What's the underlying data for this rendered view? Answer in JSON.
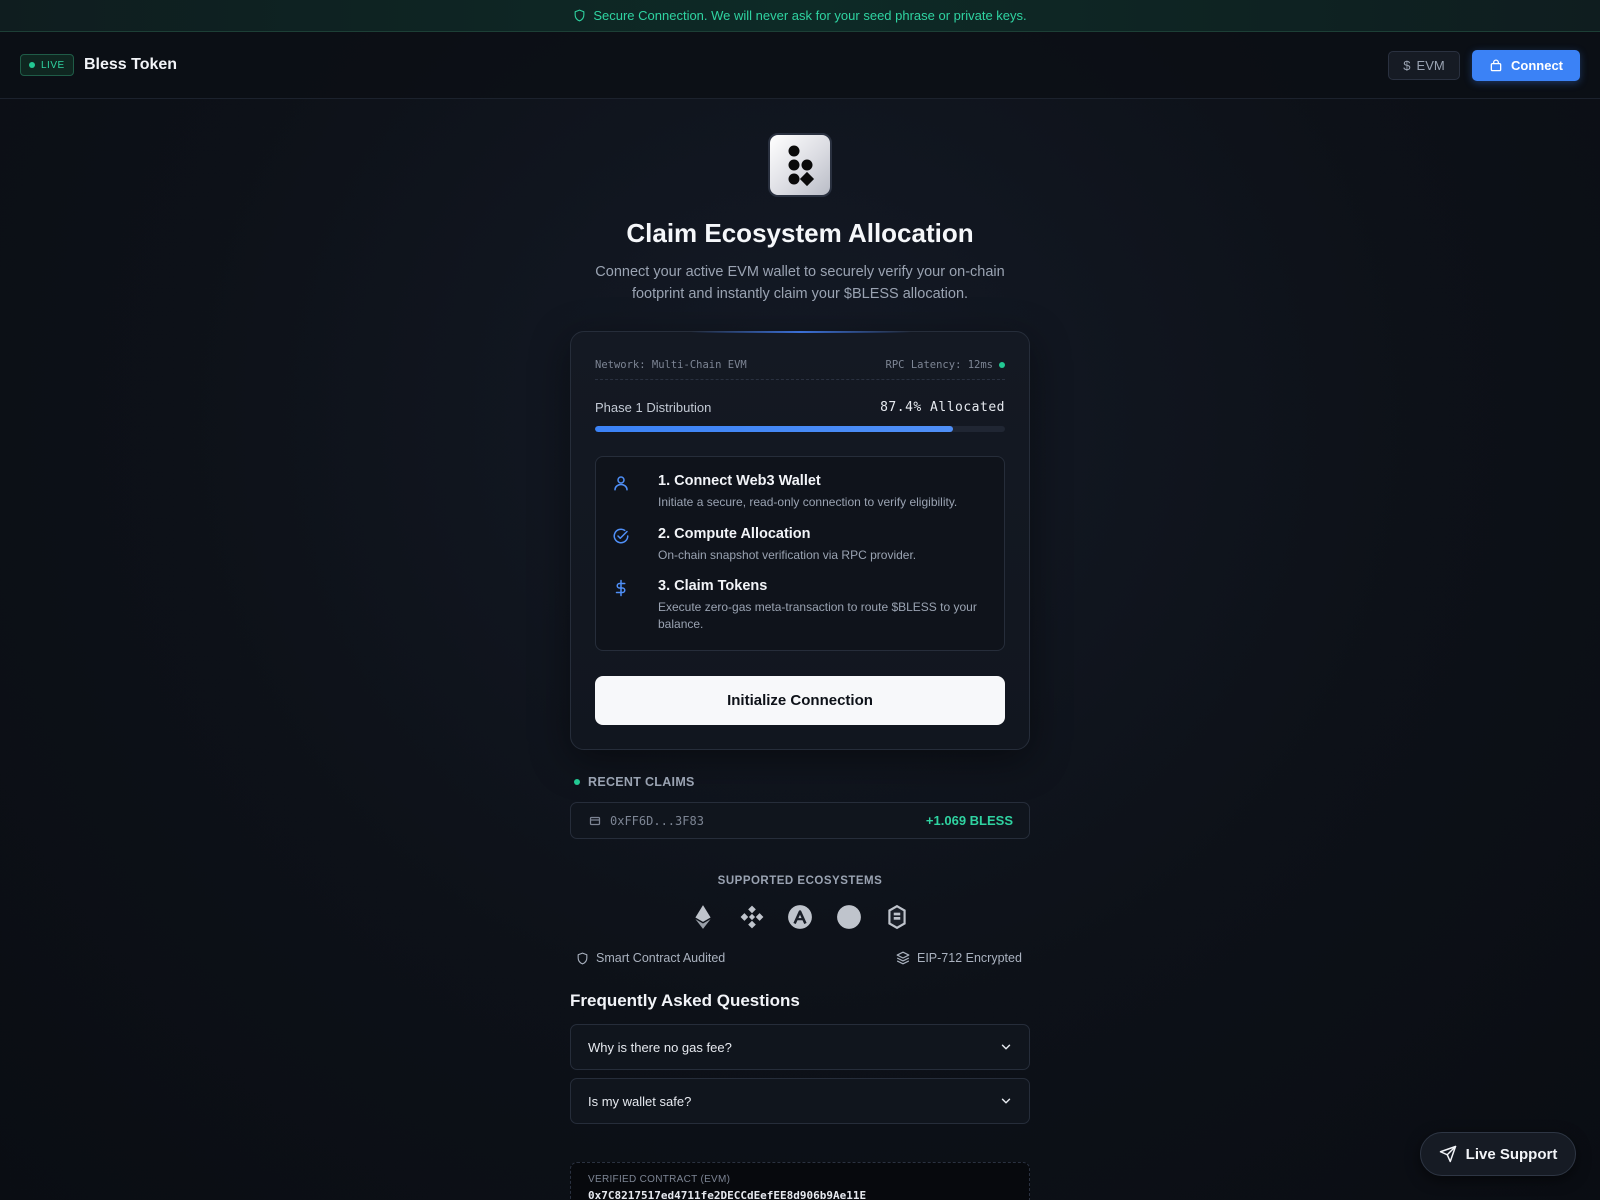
{
  "banner": {
    "text": "Secure Connection. We will never ask for your seed phrase or private keys."
  },
  "header": {
    "live_label": "LIVE",
    "brand": "Bless Token",
    "network_button": "EVM",
    "connect_button": "Connect"
  },
  "hero": {
    "title": "Claim Ecosystem Allocation",
    "subtitle": "Connect your active EVM wallet to securely verify your on-chain footprint and instantly claim your $BLESS allocation."
  },
  "card": {
    "network": "Network: Multi-Chain EVM",
    "rpc_latency": "RPC Latency: 12ms",
    "phase_label": "Phase 1 Distribution",
    "phase_value": "87.4% Allocated",
    "progress_fraction": 0.874,
    "steps": [
      {
        "title": "1. Connect Web3 Wallet",
        "desc": "Initiate a secure, read-only connection to verify eligibility.",
        "icon": "user-icon"
      },
      {
        "title": "2. Compute Allocation",
        "desc": "On-chain snapshot verification via RPC provider.",
        "icon": "check-circle-icon"
      },
      {
        "title": "3. Claim Tokens",
        "desc": "Execute zero-gas meta-transaction to route $BLESS to your balance.",
        "icon": "dollar-icon"
      }
    ],
    "init_button": "Initialize Connection"
  },
  "recent_claims": {
    "label": "RECENT CLAIMS",
    "items": [
      {
        "address": "0xFF6D...3F83",
        "amount": "+1.069 BLESS"
      }
    ]
  },
  "ecosystems": {
    "label": "SUPPORTED ECOSYSTEMS",
    "icons": [
      "ethereum-icon",
      "bnb-icon",
      "arbitrum-icon",
      "polygon-icon",
      "base-icon"
    ]
  },
  "trust": {
    "left": "Smart Contract Audited",
    "right": "EIP-712 Encrypted"
  },
  "faq": {
    "title": "Frequently Asked Questions",
    "items": [
      {
        "question": "Why is there no gas fee?"
      },
      {
        "question": "Is my wallet safe?"
      }
    ]
  },
  "contract": {
    "label": "VERIFIED CONTRACT (EVM)",
    "address": "0x7C8217517ed4711fe2DECCdEefEE8d906b9Ae11E"
  },
  "support": {
    "label": "Live Support"
  },
  "colors": {
    "accent": "#3b82f6",
    "success": "#2fd3a1",
    "background": "#0d1118"
  }
}
